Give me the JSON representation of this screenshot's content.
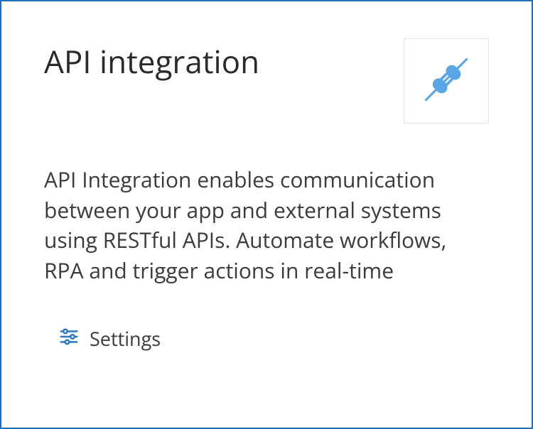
{
  "card": {
    "title": "API integration",
    "description": "API Integration enables communication between your app and external systems using RESTful APIs. Automate workflows, RPA and trigger actions in real-time",
    "settings_label": "Settings"
  },
  "colors": {
    "border": "#1f6fc0",
    "icon": "#59a6e6",
    "settings_icon": "#2b77c0",
    "text": "#3b3b3b"
  },
  "icons": {
    "header": "plug-icon",
    "settings": "sliders-icon"
  }
}
